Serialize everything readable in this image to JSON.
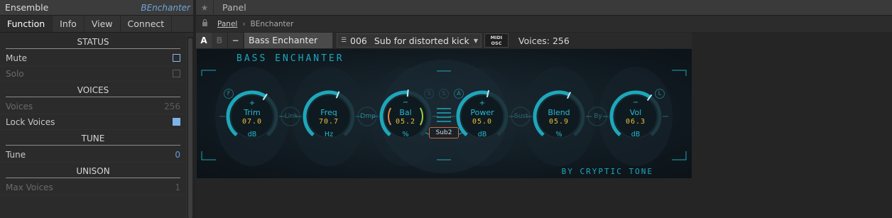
{
  "inspector": {
    "title": "Ensemble",
    "instance_name": "BEnchanter",
    "tabs": [
      "Function",
      "Info",
      "View",
      "Connect"
    ],
    "active_tab": "Function",
    "sections": {
      "status": "STATUS",
      "voices": "VOICES",
      "tune": "TUNE",
      "unison": "UNISON"
    },
    "rows": {
      "mute": {
        "label": "Mute"
      },
      "solo": {
        "label": "Solo"
      },
      "voices": {
        "label": "Voices",
        "value": "256"
      },
      "lock_voices": {
        "label": "Lock Voices"
      },
      "tune": {
        "label": "Tune",
        "value": "0"
      },
      "max_voices": {
        "label": "Max Voices",
        "value": "1"
      }
    }
  },
  "panel": {
    "title": "Panel",
    "breadcrumb": [
      "Panel",
      "BEnchanter"
    ],
    "header": {
      "a_label": "A",
      "b_label": "B",
      "minus_label": "−",
      "instrument_name": "Bass Enchanter",
      "preset_number": "006",
      "preset_name": "Sub for distorted kick ...",
      "midi_line1": "MIDI",
      "midi_line2": "OSC",
      "voices_text": "Voices: 256"
    }
  },
  "instrument": {
    "title": "BASS ENCHANTER",
    "credit": "BY CRYPTIC TONE",
    "knobs": [
      {
        "label": "Trim",
        "value": "07.0",
        "unit": "dB",
        "sign": "+"
      },
      {
        "label": "Freq",
        "value": "70.7",
        "unit": "Hz",
        "sign": ""
      },
      {
        "label": "Bal",
        "value": "05.2",
        "unit": "%",
        "sign": "−"
      },
      {
        "label": "Power",
        "value": "05.0",
        "unit": "dB",
        "sign": "+"
      },
      {
        "label": "Blend",
        "value": "05.9",
        "unit": "%",
        "sign": ""
      },
      {
        "label": "Vol",
        "value": "06.3",
        "unit": "dB",
        "sign": "−"
      }
    ],
    "knob_fractions": [
      0.62,
      0.58,
      0.52,
      0.55,
      0.59,
      0.63
    ],
    "links": [
      "Link",
      "Dmp",
      "Sust",
      "By"
    ],
    "buttons": {
      "f": "F",
      "l": "L",
      "s1": "S",
      "s2": "S",
      "a": "A"
    },
    "sub_label": "Sub2",
    "accent_color": "#1ea7ba",
    "value_color": "#e6c13a"
  }
}
